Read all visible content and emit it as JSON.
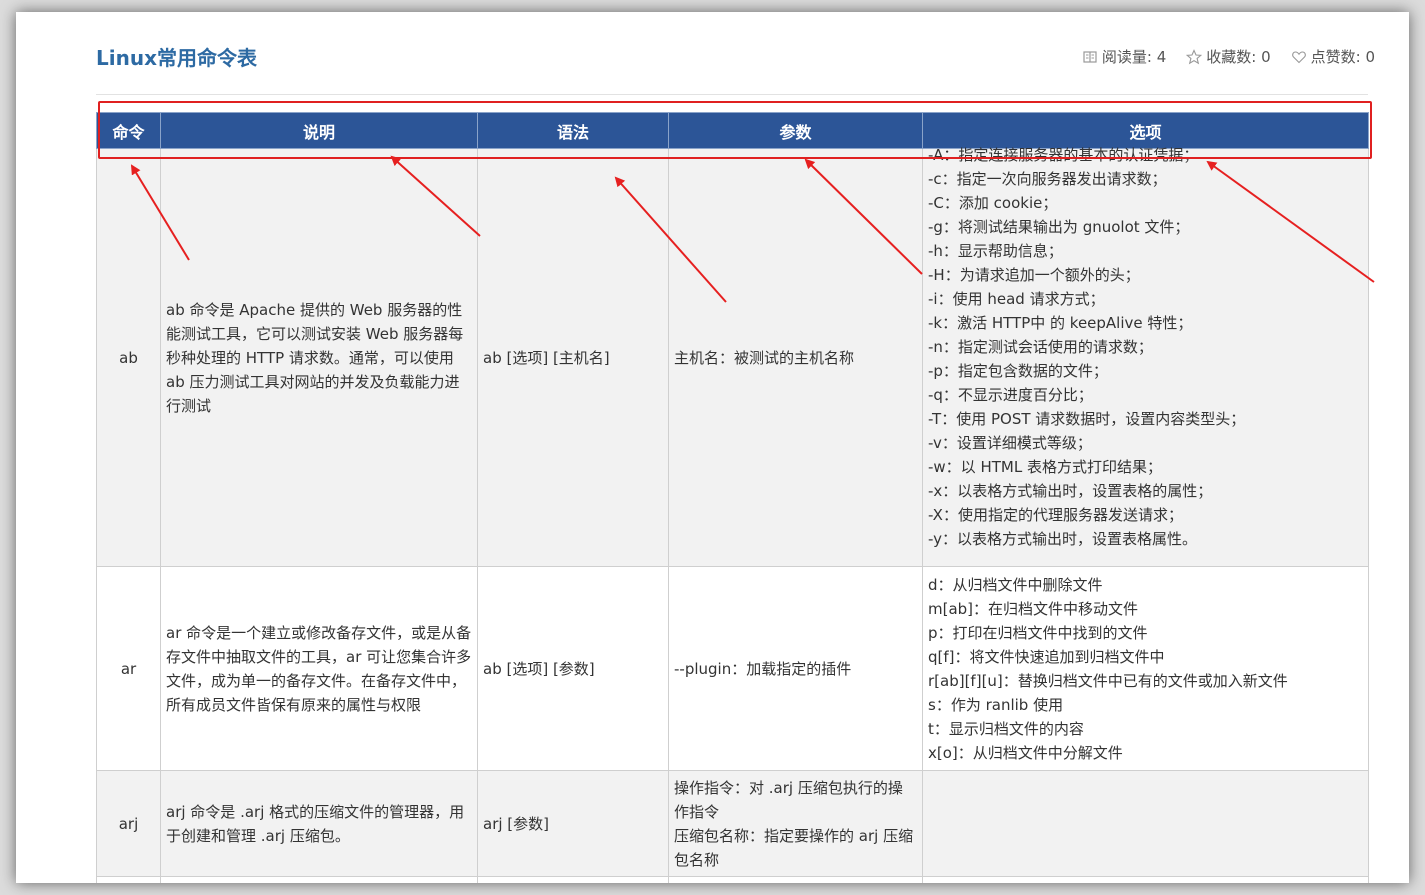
{
  "page": {
    "title": "Linux常用命令表",
    "stats": [
      {
        "icon": "reading-icon",
        "label": "阅读量: 4"
      },
      {
        "icon": "star-icon",
        "label": "收藏数: 0"
      },
      {
        "icon": "heart-icon",
        "label": "点赞数: 0"
      }
    ]
  },
  "table": {
    "headers": [
      "命令",
      "说明",
      "语法",
      "参数",
      "选项"
    ],
    "rows": [
      {
        "command": "ab",
        "description": "ab 命令是 Apache 提供的 Web 服务器的性能测试工具，它可以测试安装 Web 服务器每秒种处理的 HTTP 请求数。通常，可以使用 ab 压力测试工具对网站的并发及负载能力进行测试",
        "syntax": "ab [选项] [主机名]",
        "params": [
          "主机名：被测试的主机名称"
        ],
        "options": [
          "-A：指定连接服务器的基本的认证凭据；",
          "-c：指定一次向服务器发出请求数；",
          "-C：添加 cookie；",
          "-g：将测试结果输出为 gnuolot 文件；",
          "-h：显示帮助信息；",
          "-H：为请求追加一个额外的头；",
          "-i：使用 head 请求方式；",
          "-k：激活 HTTP中 的 keepAlive 特性；",
          "-n：指定测试会话使用的请求数；",
          "-p：指定包含数据的文件；",
          "-q：不显示进度百分比；",
          "-T：使用 POST 请求数据时，设置内容类型头；",
          "-v：设置详细模式等级；",
          "-w：以 HTML 表格方式打印结果；",
          "-x：以表格方式输出时，设置表格的属性；",
          "-X：使用指定的代理服务器发送请求；",
          "-y：以表格方式输出时，设置表格属性。"
        ]
      },
      {
        "command": "ar",
        "description": "ar 命令是一个建立或修改备存文件，或是从备存文件中抽取文件的工具，ar 可让您集合许多文件，成为单一的备存文件。在备存文件中，所有成员文件皆保有原来的属性与权限",
        "syntax": "ab [选项] [参数]",
        "params": [
          "--plugin：加载指定的插件"
        ],
        "options": [
          "d：从归档文件中删除文件",
          "m[ab]：在归档文件中移动文件",
          "p：打印在归档文件中找到的文件",
          "q[f]：将文件快速追加到归档文件中",
          "r[ab][f][u]：替换归档文件中已有的文件或加入新文件",
          "s：作为 ranlib 使用",
          "t：显示归档文件的内容",
          "x[o]：从归档文件中分解文件"
        ]
      },
      {
        "command": "arj",
        "description": "arj 命令是 .arj 格式的压缩文件的管理器，用于创建和管理 .arj 压缩包。",
        "syntax": "arj [参数]",
        "params": [
          "操作指令：对 .arj 压缩包执行的操作指令",
          "压缩包名称：指定要操作的 arj 压缩包名称"
        ],
        "options": []
      }
    ]
  },
  "annotation": {
    "highlight_color": "#e02020",
    "arrow_color": "#e62020"
  },
  "colors": {
    "header_bg": "#2c5597",
    "title": "#2d6aa3"
  }
}
